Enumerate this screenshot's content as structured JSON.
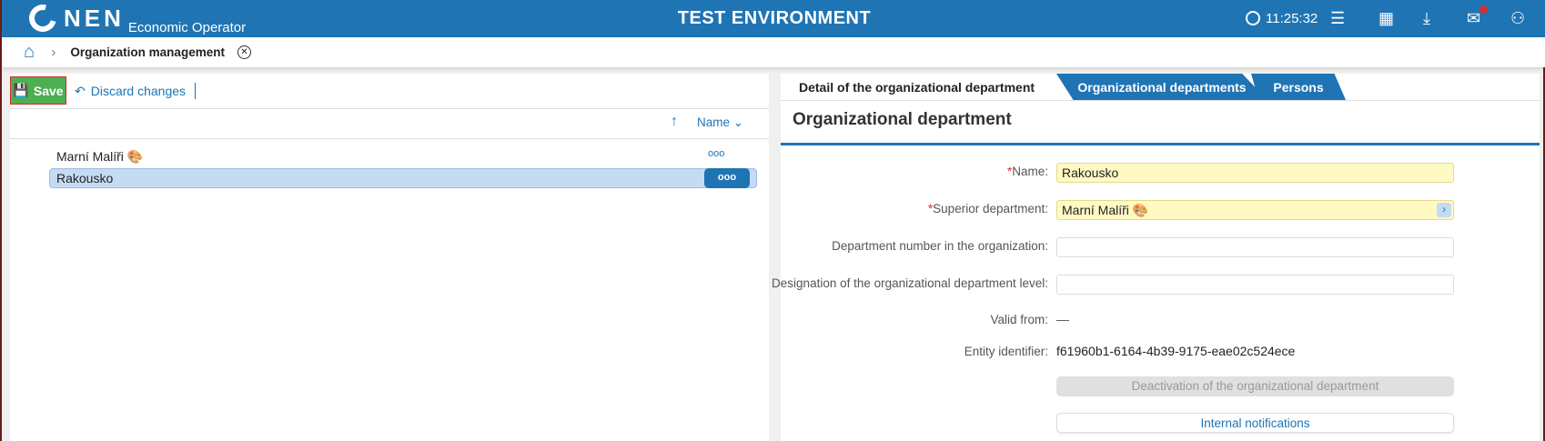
{
  "header": {
    "brand": "NEN",
    "subtitle": "Economic Operator",
    "environment": "TEST ENVIRONMENT",
    "time": "11:25:32",
    "icons": [
      "clock-icon",
      "menu-icon",
      "calendar-icon",
      "download-icon",
      "mail-icon",
      "user-icon"
    ]
  },
  "breadcrumb": {
    "current": "Organization management"
  },
  "toolbar": {
    "save": "Save",
    "discard": "Discard changes"
  },
  "list": {
    "sort_label": "Name",
    "items": [
      {
        "name": "Marní Malíři",
        "emoji": "🎨",
        "selected": false
      },
      {
        "name": "Rakousko",
        "selected": true
      }
    ],
    "more": "ooo"
  },
  "tabs": [
    {
      "label": "Detail of the organizational department",
      "active": true
    },
    {
      "label": "Organizational departments",
      "active": false
    },
    {
      "label": "Persons",
      "active": false
    }
  ],
  "form": {
    "section_title": "Organizational department",
    "name_label": "Name:",
    "name_value": "Rakousko",
    "superior_label": "Superior department:",
    "superior_value": "Marní Malíři 🎨",
    "number_label": "Department number in the organization:",
    "number_value": "",
    "level_label": "Designation of the organizational department level:",
    "level_value": "",
    "valid_label": "Valid from:",
    "valid_value": "—",
    "entity_label": "Entity identifier:",
    "entity_value": "f61960b1-6164-4b39-9175-eae02c524ece",
    "deactivate": "Deactivation of the organizational department",
    "notifications": "Internal notifications"
  },
  "colors": {
    "brand": "#1f74b4",
    "save": "#4caf50",
    "required_bg": "#fff9c4",
    "selected_row": "#c5dbf4"
  }
}
